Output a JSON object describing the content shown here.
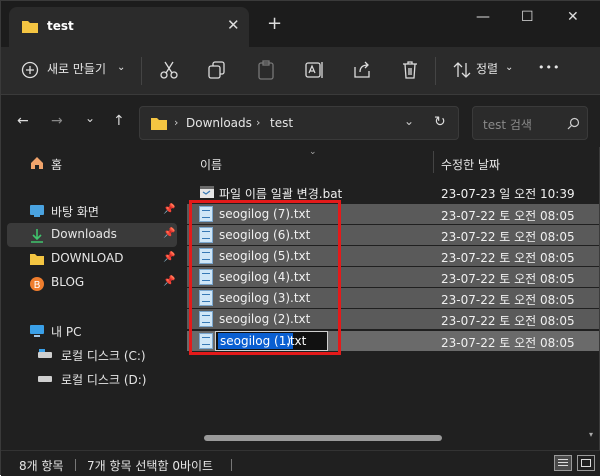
{
  "window": {
    "tab_title": "test",
    "new_tab": "+",
    "close_tab": "✕",
    "minimize": "—",
    "maximize": "☐",
    "close": "✕"
  },
  "toolbar": {
    "new_label": "새로 만들기",
    "sort_label": "정렬",
    "more": "•••"
  },
  "address": {
    "breadcrumb": [
      "Downloads",
      "test"
    ],
    "search_placeholder": "test 검색"
  },
  "sidebar": {
    "items": [
      {
        "label": "홈",
        "icon": "home-icon"
      },
      {
        "label": "바탕 화면",
        "icon": "desktop-icon",
        "pinned": true
      },
      {
        "label": "Downloads",
        "icon": "download-icon",
        "pinned": true,
        "active": true
      },
      {
        "label": "DOWNLOAD",
        "icon": "folder-icon",
        "pinned": true
      },
      {
        "label": "BLOG",
        "icon": "blog-icon",
        "pinned": true
      },
      {
        "label": "내 PC",
        "icon": "pc-icon"
      },
      {
        "label": "로컬 디스크 (C:)",
        "icon": "drive-c-icon"
      },
      {
        "label": "로컬 디스크 (D:)",
        "icon": "drive-d-icon"
      }
    ]
  },
  "columns": {
    "name": "이름",
    "modified": "수정한 날짜"
  },
  "files": [
    {
      "name": "파일 이름 일괄 변경.bat",
      "date": "23-07-23 일 오전 10:39",
      "selected": false
    },
    {
      "name": "seogilog (7).txt",
      "date": "23-07-22 토 오전 08:05",
      "selected": true
    },
    {
      "name": "seogilog (6).txt",
      "date": "23-07-22 토 오전 08:05",
      "selected": true
    },
    {
      "name": "seogilog (5).txt",
      "date": "23-07-22 토 오전 08:05",
      "selected": true
    },
    {
      "name": "seogilog (4).txt",
      "date": "23-07-22 토 오전 08:05",
      "selected": true
    },
    {
      "name": "seogilog (3).txt",
      "date": "23-07-22 토 오전 08:05",
      "selected": true
    },
    {
      "name": "seogilog (2).txt",
      "date": "23-07-22 토 오전 08:05",
      "selected": true
    },
    {
      "name": "seogilog (1).txt",
      "date": "23-07-22 토 오전 08:05",
      "selected": true
    }
  ],
  "rename": {
    "selected_text": "seogilog (1)",
    "extension": ".txt"
  },
  "status": {
    "item_count": "8개 항목",
    "selection": "7개 항목 선택함 0바이트"
  },
  "colors": {
    "accent": "#0a5fd1",
    "highlight_box": "#e41a1a",
    "folder": "#f4c542"
  }
}
